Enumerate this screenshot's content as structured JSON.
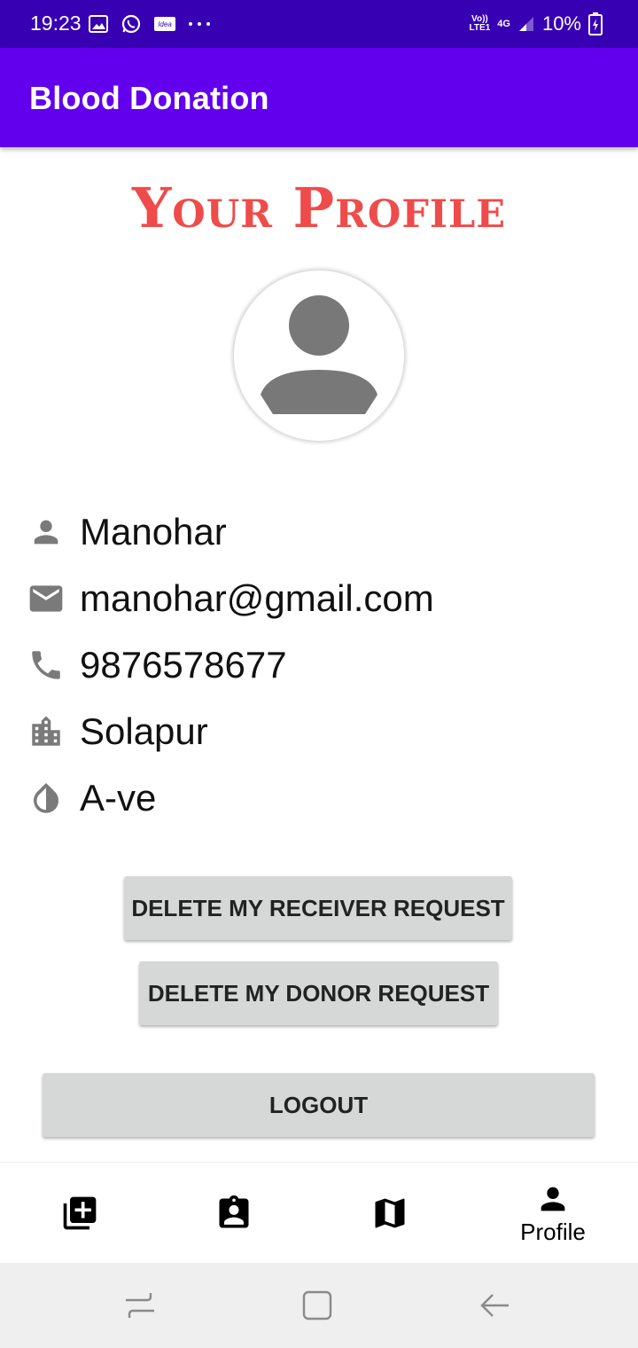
{
  "status_bar": {
    "time": "19:23",
    "left_icons": [
      "gallery-icon",
      "whatsapp-icon",
      "idea-icon",
      "more-icon"
    ],
    "idea_label": "Idea",
    "volte_top": "Vo))",
    "volte_bottom": "LTE1",
    "network": "4G",
    "battery": "10%"
  },
  "app_bar": {
    "title": "Blood Donation"
  },
  "profile": {
    "heading": "Your Profile",
    "name": "Manohar",
    "email": "manohar@gmail.com",
    "phone": "9876578677",
    "city": "Solapur",
    "blood_group": "A-ve"
  },
  "buttons": {
    "delete_receiver": "DELETE MY RECEIVER REQUEST",
    "delete_donor": "DELETE MY DONOR REQUEST",
    "logout": "LOGOUT"
  },
  "bottom_nav": {
    "items": [
      {
        "icon": "add-request-icon",
        "label": ""
      },
      {
        "icon": "donor-badge-icon",
        "label": ""
      },
      {
        "icon": "map-icon",
        "label": ""
      },
      {
        "icon": "person-icon",
        "label": "Profile"
      }
    ]
  },
  "colors": {
    "status_bar": "#3700b3",
    "app_bar": "#6200ee",
    "heading": "#ef4b4b",
    "icon_gray": "#7a7a7a",
    "button_bg": "#d6d7d7"
  }
}
